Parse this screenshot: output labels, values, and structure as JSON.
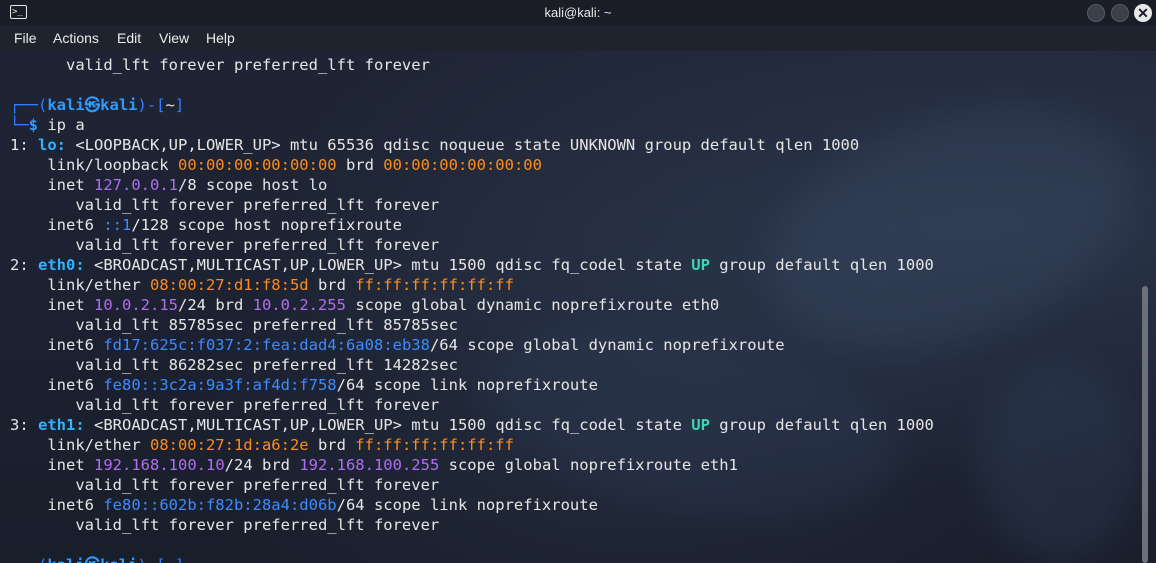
{
  "window": {
    "title": "kali@kali: ~"
  },
  "menu": [
    "File",
    "Actions",
    "Edit",
    "View",
    "Help"
  ],
  "terminal": {
    "lines": [
      [
        [
          "",
          "      valid_lft forever preferred_lft forever"
        ]
      ],
      [
        [
          "",
          ""
        ]
      ],
      [
        [
          "pblue",
          "┌──("
        ],
        [
          "blue",
          "kali㉿kali"
        ],
        [
          "pblue",
          ")-["
        ],
        [
          "",
          "~"
        ],
        [
          "pblue",
          "]"
        ]
      ],
      [
        [
          "pblue",
          "└─"
        ],
        [
          "blue",
          "$"
        ],
        [
          "",
          " ip a"
        ]
      ],
      [
        [
          "",
          "1: "
        ],
        [
          "ifblue",
          "lo:"
        ],
        [
          "",
          " <LOOPBACK,UP,LOWER_UP> mtu 65536 qdisc noqueue state UNKNOWN group default qlen 1000"
        ]
      ],
      [
        [
          "",
          "    link/loopback "
        ],
        [
          "orange",
          "00:00:00:00:00:00"
        ],
        [
          "",
          " brd "
        ],
        [
          "orange",
          "00:00:00:00:00:00"
        ]
      ],
      [
        [
          "",
          "    inet "
        ],
        [
          "purple",
          "127.0.0.1"
        ],
        [
          "",
          "/8 scope host lo"
        ]
      ],
      [
        [
          "",
          "       valid_lft forever preferred_lft forever"
        ]
      ],
      [
        [
          "",
          "    inet6 "
        ],
        [
          "v6",
          "::1"
        ],
        [
          "",
          "/128 scope host noprefixroute"
        ]
      ],
      [
        [
          "",
          "       valid_lft forever preferred_lft forever"
        ]
      ],
      [
        [
          "",
          "2: "
        ],
        [
          "ifblue",
          "eth0:"
        ],
        [
          "",
          " <BROADCAST,MULTICAST,UP,LOWER_UP> mtu 1500 qdisc fq_codel state "
        ],
        [
          "green",
          "UP"
        ],
        [
          "",
          " group default qlen 1000"
        ]
      ],
      [
        [
          "",
          "    link/ether "
        ],
        [
          "orange",
          "08:00:27:d1:f8:5d"
        ],
        [
          "",
          " brd "
        ],
        [
          "orange",
          "ff:ff:ff:ff:ff:ff"
        ]
      ],
      [
        [
          "",
          "    inet "
        ],
        [
          "purple",
          "10.0.2.15"
        ],
        [
          "",
          "/24 brd "
        ],
        [
          "purple",
          "10.0.2.255"
        ],
        [
          "",
          " scope global dynamic noprefixroute eth0"
        ]
      ],
      [
        [
          "",
          "       valid_lft 85785sec preferred_lft 85785sec"
        ]
      ],
      [
        [
          "",
          "    inet6 "
        ],
        [
          "v6",
          "fd17:625c:f037:2:fea:dad4:6a08:eb38"
        ],
        [
          "",
          "/64 scope global dynamic noprefixroute"
        ]
      ],
      [
        [
          "",
          "       valid_lft 86282sec preferred_lft 14282sec"
        ]
      ],
      [
        [
          "",
          "    inet6 "
        ],
        [
          "v6",
          "fe80::3c2a:9a3f:af4d:f758"
        ],
        [
          "",
          "/64 scope link noprefixroute"
        ]
      ],
      [
        [
          "",
          "       valid_lft forever preferred_lft forever"
        ]
      ],
      [
        [
          "",
          "3: "
        ],
        [
          "ifblue",
          "eth1:"
        ],
        [
          "",
          " <BROADCAST,MULTICAST,UP,LOWER_UP> mtu 1500 qdisc fq_codel state "
        ],
        [
          "green",
          "UP"
        ],
        [
          "",
          " group default qlen 1000"
        ]
      ],
      [
        [
          "",
          "    link/ether "
        ],
        [
          "orange",
          "08:00:27:1d:a6:2e"
        ],
        [
          "",
          " brd "
        ],
        [
          "orange",
          "ff:ff:ff:ff:ff:ff"
        ]
      ],
      [
        [
          "",
          "    inet "
        ],
        [
          "purple",
          "192.168.100.10"
        ],
        [
          "",
          "/24 brd "
        ],
        [
          "purple",
          "192.168.100.255"
        ],
        [
          "",
          " scope global noprefixroute eth1"
        ]
      ],
      [
        [
          "",
          "       valid_lft forever preferred_lft forever"
        ]
      ],
      [
        [
          "",
          "    inet6 "
        ],
        [
          "v6",
          "fe80::602b:f82b:28a4:d06b"
        ],
        [
          "",
          "/64 scope link noprefixroute"
        ]
      ],
      [
        [
          "",
          "       valid_lft forever preferred_lft forever"
        ]
      ],
      [
        [
          "",
          ""
        ]
      ],
      [
        [
          "pblue",
          "┌──("
        ],
        [
          "blue",
          "kali㉿kali"
        ],
        [
          "pblue",
          ")-["
        ],
        [
          "",
          "~"
        ],
        [
          "pblue",
          "]"
        ]
      ]
    ]
  },
  "icons": {
    "app": "terminal-icon",
    "minimize": "minimize-icon",
    "maximize": "maximize-icon",
    "close": "close-icon"
  },
  "colors": {
    "mac": "#ff8c1a",
    "ipv4": "#b06ef0",
    "ipv6": "#3d8bff",
    "interface": "#2fb2ff",
    "state_up": "#3fd5b0",
    "prompt": "#2f7fff"
  }
}
